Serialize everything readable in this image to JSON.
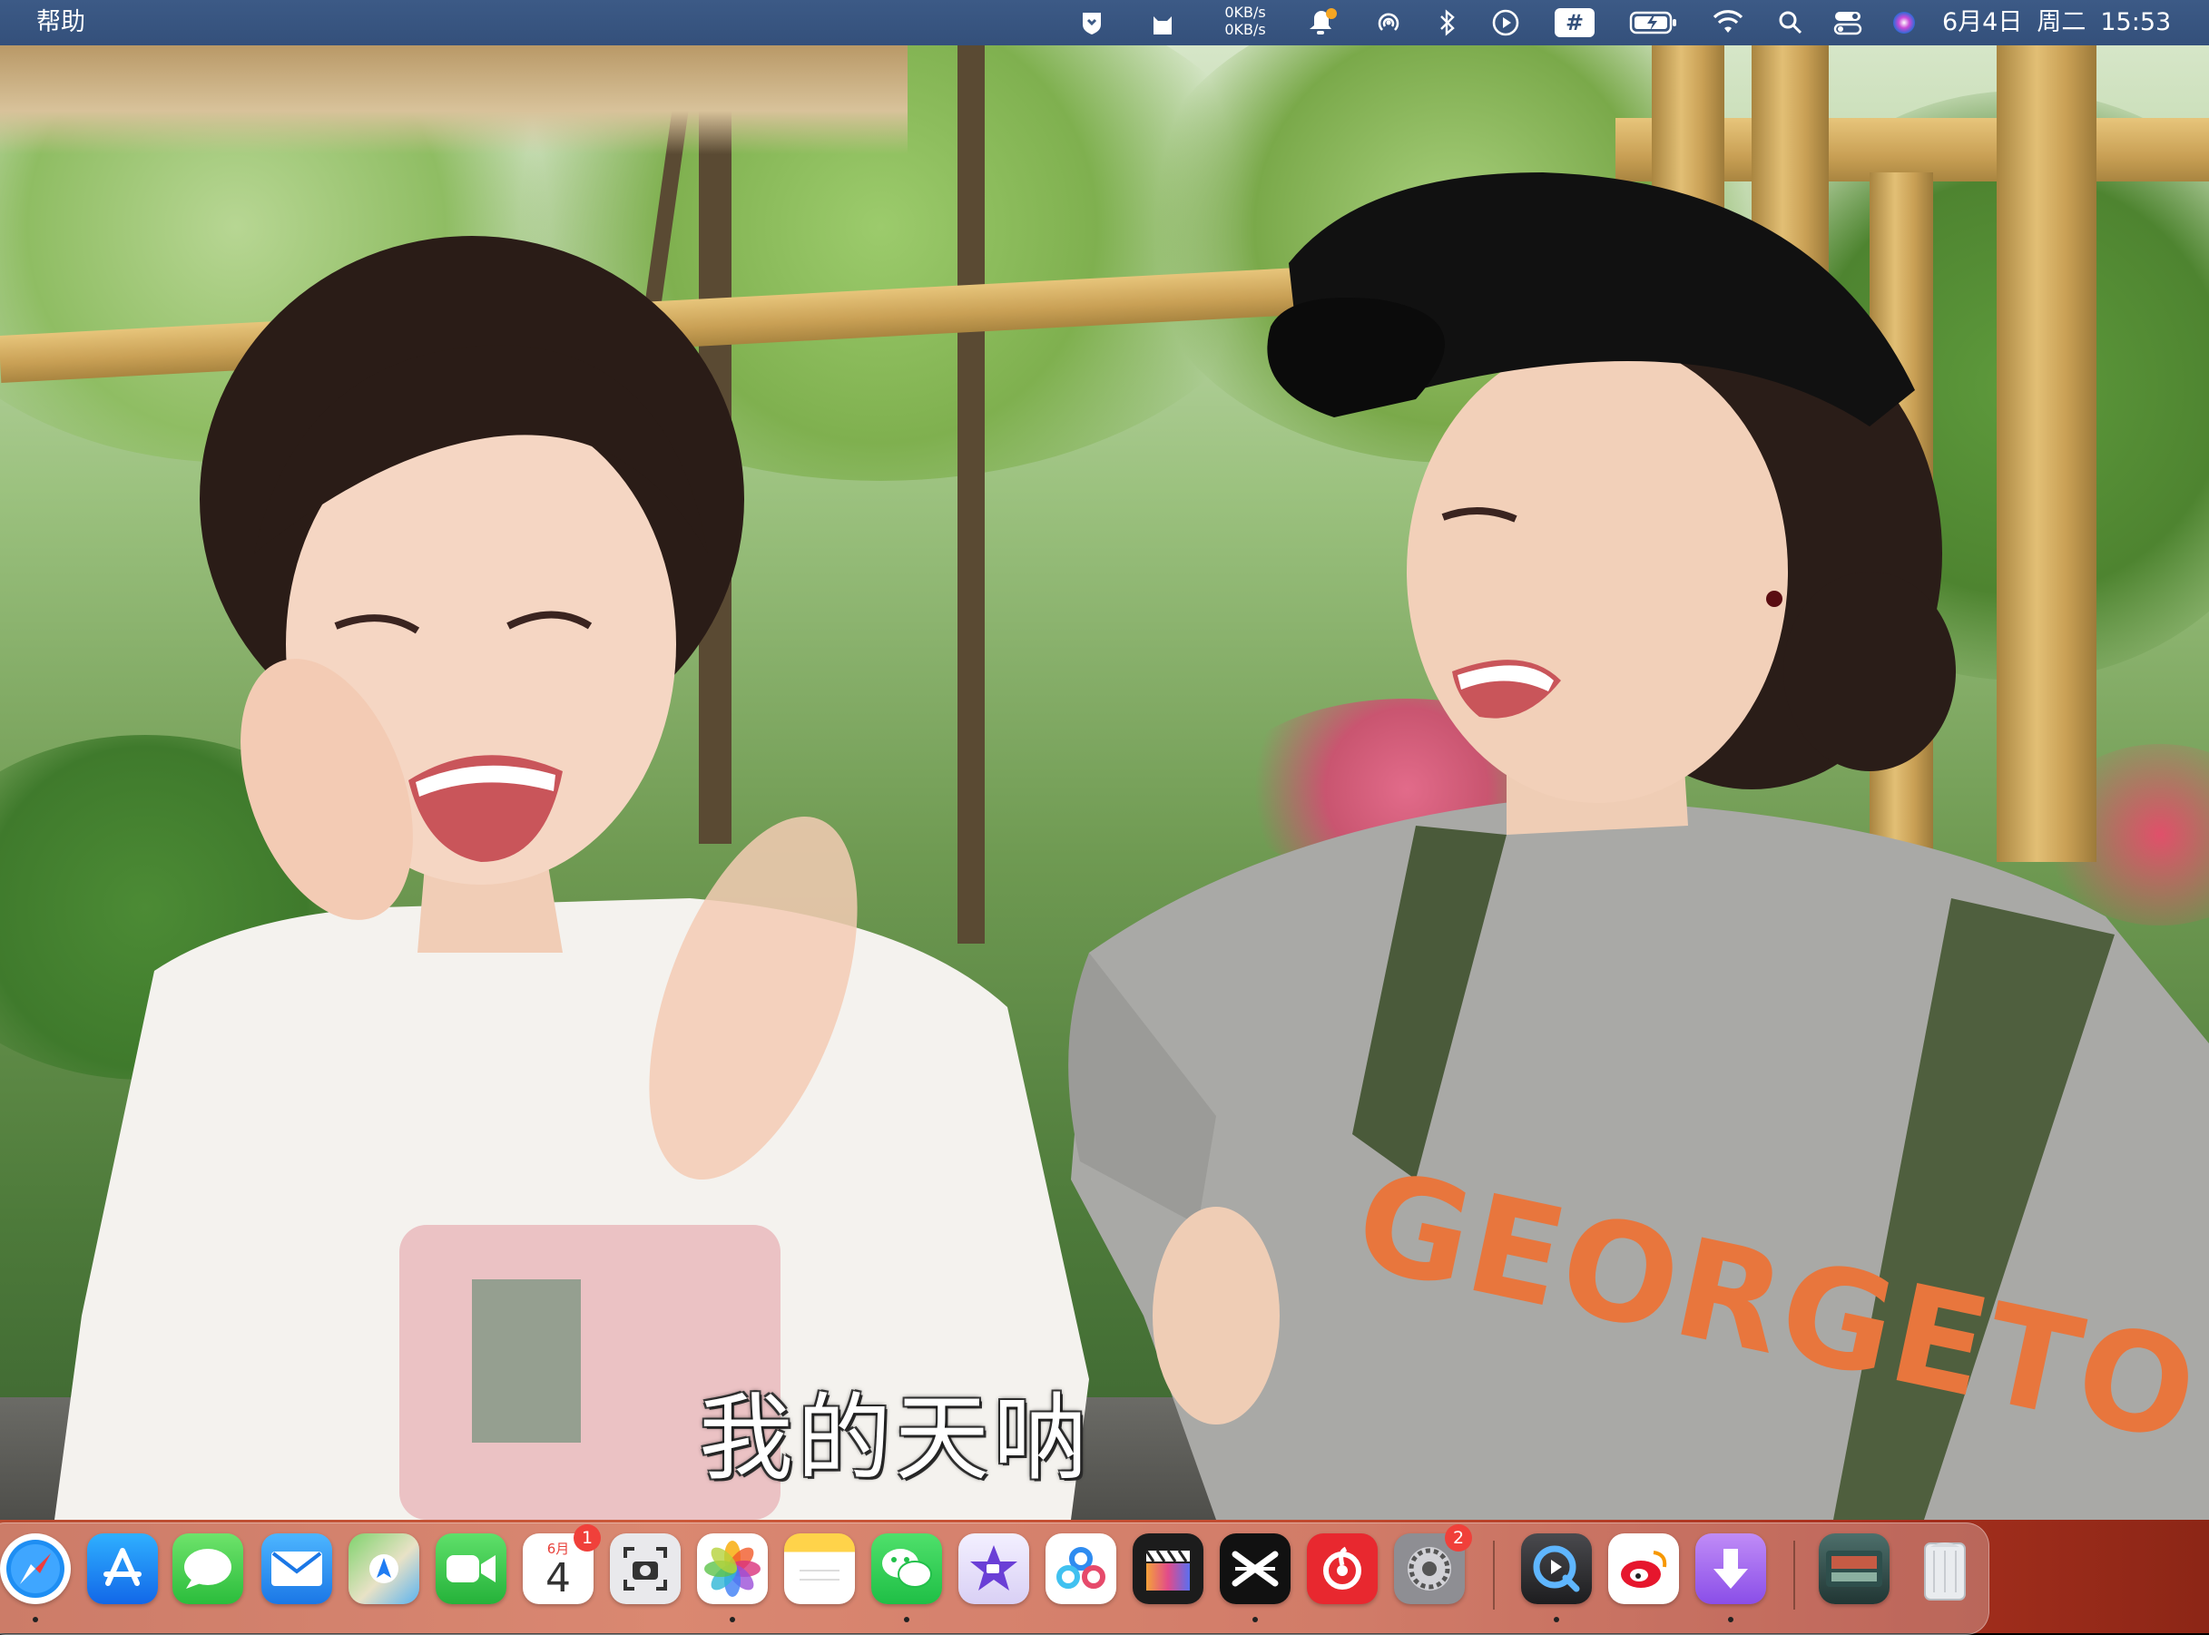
{
  "menubar": {
    "app_menu": "帮助",
    "net_speed": {
      "up": "0KB/s",
      "down": "0KB/s"
    },
    "clock": {
      "date": "6月4日",
      "weekday": "周二",
      "time": "15:53"
    },
    "status_icons": [
      "shield-icon",
      "cat-icon",
      "notification-bell-icon",
      "airdrop-icon",
      "bluetooth-icon",
      "play-icon",
      "input-method-icon",
      "battery-icon",
      "wifi-icon",
      "search-icon",
      "control-center-icon",
      "siri-icon"
    ]
  },
  "video": {
    "subtitle": "我的天呐",
    "sweatshirt_text": "GEORGETOWN"
  },
  "dock": {
    "calendar": {
      "month": "6月",
      "day": "4",
      "badge": "1"
    },
    "settings_badge": "2",
    "apps": [
      "Safari",
      "App Store",
      "Messages",
      "Mail",
      "Maps",
      "FaceTime",
      "Calendar",
      "Screenshot",
      "Photos",
      "Notes",
      "WeChat",
      "iMovie",
      "Baidu Netdisk",
      "Final Cut Pro",
      "CapCut",
      "NetEase Cloud Music",
      "System Settings",
      "QuickTime Player",
      "Weibo",
      "Downie",
      "Downloads Stack",
      "Trash"
    ]
  }
}
